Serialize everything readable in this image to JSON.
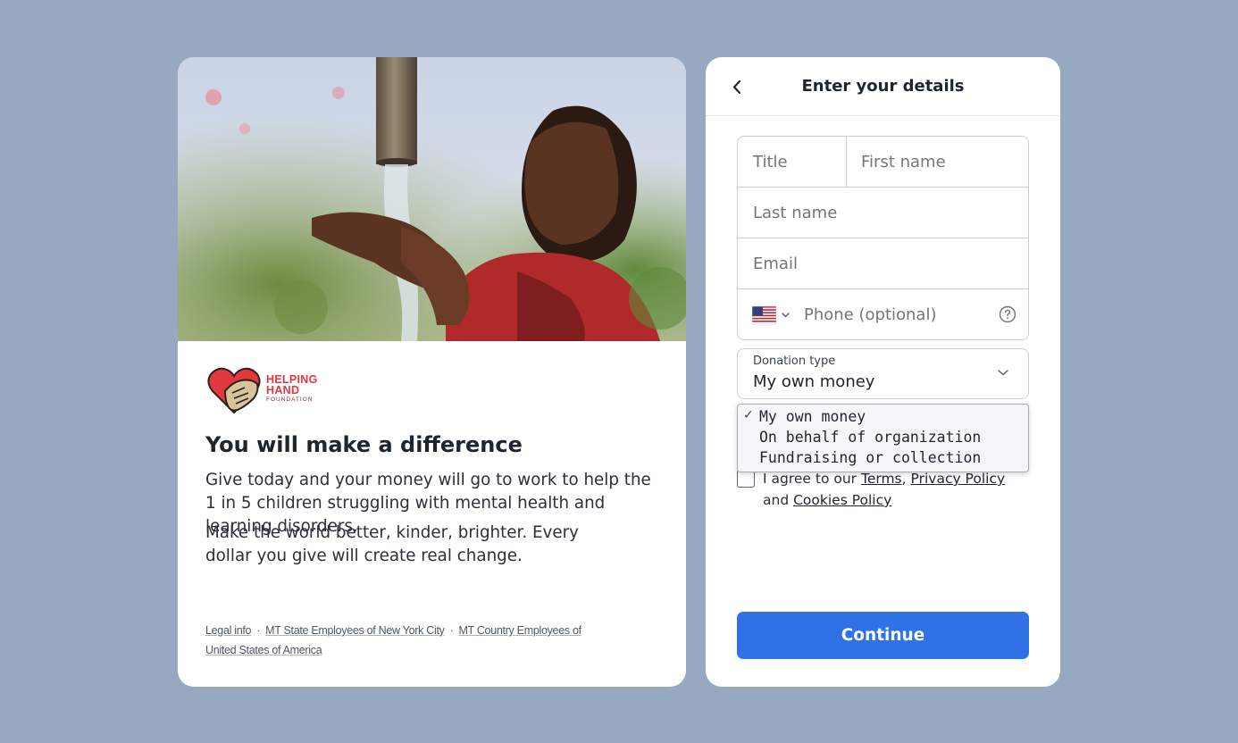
{
  "left": {
    "logo": {
      "line1": "HELPING",
      "line2": "HAND",
      "line3": "FOUNDATION"
    },
    "headline": "You will make a difference",
    "paragraph1": "Give today and your money will go to work to help the 1 in 5 children struggling with mental health and learning disorders.",
    "paragraph2": "Make the world better, kinder, brighter. Every dollar you give will create real change.",
    "footer": {
      "link1": "Legal info",
      "link2": "MT State Employees of New York City",
      "link3": "MT Country Employees of United States of America",
      "separator": "·"
    }
  },
  "form": {
    "title": "Enter your details",
    "title_placeholder": "Title",
    "first_name_placeholder": "First name",
    "last_name_placeholder": "Last name",
    "email_placeholder": "Email",
    "phone_placeholder": "Phone (optional)",
    "phone_country": "us-flag-icon",
    "donation_type_label": "Donation type",
    "donation_type_value": "My own money",
    "donation_options": [
      {
        "label": "My own money",
        "selected": true
      },
      {
        "label": "On behalf of organization",
        "selected": false
      },
      {
        "label": "Fundraising or collection",
        "selected": false
      }
    ],
    "agree": {
      "prefix": "I agree to our",
      "terms": "Terms",
      "comma": ",",
      "privacy": "Privacy Policy",
      "and": "and",
      "cookies": "Cookies Policy"
    },
    "continue_label": "Continue"
  },
  "colors": {
    "accent": "#2f72e6",
    "background": "#97a8c1",
    "brand_red": "#e03a3e"
  }
}
